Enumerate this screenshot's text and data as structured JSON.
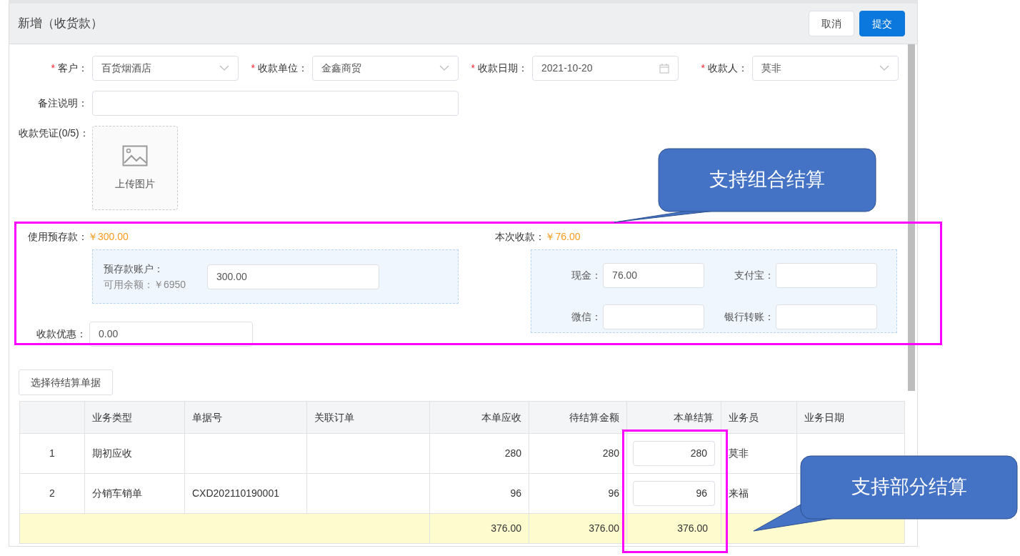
{
  "dialog": {
    "title": "新增（收货款）",
    "buttons": [
      {
        "label": "取消",
        "kind": "default"
      },
      {
        "label": "提交",
        "kind": "primary"
      }
    ]
  },
  "fields": [
    {
      "required": true,
      "required_mark": "*",
      "label": "客户：",
      "value": "百货烟酒店",
      "kind": "select"
    },
    {
      "required": true,
      "required_mark": "*",
      "label": "收款单位：",
      "value": "金鑫商贸",
      "kind": "select"
    },
    {
      "required": true,
      "required_mark": "*",
      "label": "收款日期：",
      "value": "2021-10-20",
      "kind": "date"
    },
    {
      "required": true,
      "required_mark": "*",
      "label": "收款人：",
      "value": "莫非",
      "kind": "select"
    }
  ],
  "remark": {
    "label": "备注说明："
  },
  "voucher": {
    "label": "收款凭证(0/5)：",
    "upload_label": "上传图片"
  },
  "prepay": {
    "label": "使用预存款：",
    "amount": "￥300.00",
    "account_label": "预存款账户：",
    "balance": "可用余额：￥6950",
    "value": "300.00"
  },
  "this_payment": {
    "label": "本次收款：",
    "amount": "￥76.00",
    "methods": [
      {
        "label": "现金：",
        "value": "76.00"
      },
      {
        "label": "支付宝："
      },
      {
        "label": "微信："
      },
      {
        "label": "银行转账："
      }
    ]
  },
  "discount": {
    "label": "收款优惠：",
    "value": "0.00"
  },
  "select_button": "选择待结算单据",
  "table": {
    "columns": [
      {
        "kind": "center"
      },
      {
        "label": "业务类型",
        "kind": "text"
      },
      {
        "label": "单据号",
        "kind": "text"
      },
      {
        "label": "关联订单",
        "kind": "text"
      },
      {
        "label": "本单应收",
        "kind": "number",
        "total": "376.00"
      },
      {
        "label": "待结算金额",
        "kind": "number",
        "total": "376.00"
      },
      {
        "label": "本单结算",
        "kind": "input",
        "total": "376.00"
      },
      {
        "label": "业务员",
        "kind": "text"
      },
      {
        "label": "业务日期",
        "kind": "text"
      }
    ],
    "rows": [
      {
        "cells": [
          "1",
          "期初应收",
          null,
          null,
          "280",
          "280",
          "280",
          "莫非",
          null
        ]
      },
      {
        "cells": [
          "2",
          "分销车销单",
          "CXD202110190001",
          null,
          "96",
          "96",
          "96",
          "来福",
          null
        ]
      }
    ]
  },
  "annotations": [
    {
      "text": "支持组合结算"
    },
    {
      "text": "支持部分结算"
    }
  ]
}
